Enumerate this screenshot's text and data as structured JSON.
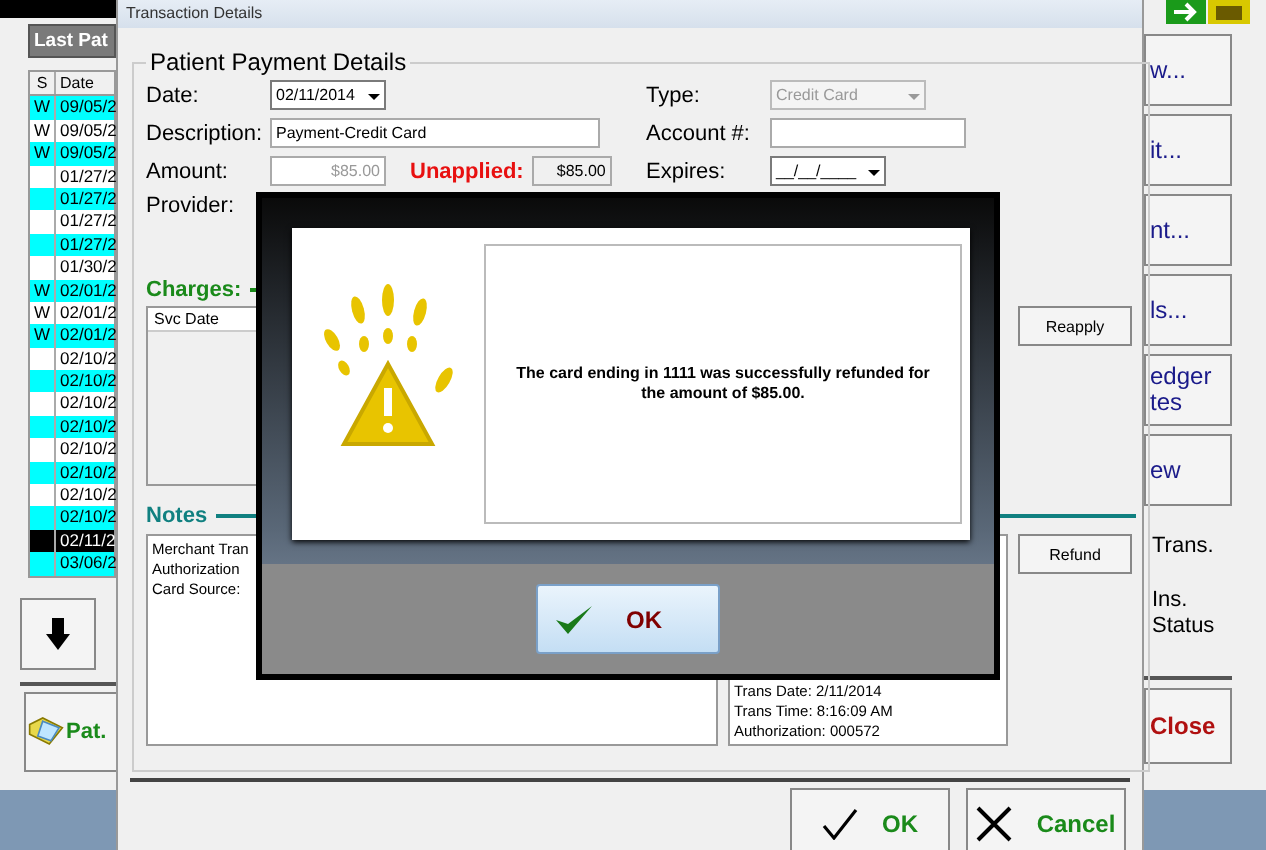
{
  "main_window": {
    "list_header": "Last Pat",
    "columns": [
      "S",
      "Date"
    ],
    "rows": [
      {
        "s": "W",
        "date": "09/05/2",
        "color": "#00ffff",
        "selected": false
      },
      {
        "s": "W",
        "date": "09/05/2",
        "color": "#ffffff",
        "selected": false
      },
      {
        "s": "W",
        "date": "09/05/2",
        "color": "#00ffff",
        "selected": false
      },
      {
        "s": "",
        "date": "01/27/2",
        "color": "#ffffff",
        "selected": false
      },
      {
        "s": "",
        "date": "01/27/2",
        "color": "#00ffff",
        "selected": false
      },
      {
        "s": "",
        "date": "01/27/2",
        "color": "#ffffff",
        "selected": false
      },
      {
        "s": "",
        "date": "01/27/2",
        "color": "#00ffff",
        "selected": false
      },
      {
        "s": "",
        "date": "01/30/2",
        "color": "#ffffff",
        "selected": false
      },
      {
        "s": "W",
        "date": "02/01/2",
        "color": "#00ffff",
        "selected": false
      },
      {
        "s": "W",
        "date": "02/01/2",
        "color": "#ffffff",
        "selected": false
      },
      {
        "s": "W",
        "date": "02/01/2",
        "color": "#00ffff",
        "selected": false
      },
      {
        "s": "",
        "date": "02/10/2",
        "color": "#ffffff",
        "selected": false
      },
      {
        "s": "",
        "date": "02/10/2",
        "color": "#00ffff",
        "selected": false
      },
      {
        "s": "",
        "date": "02/10/2",
        "color": "#ffffff",
        "selected": false
      },
      {
        "s": "",
        "date": "02/10/2",
        "color": "#00ffff",
        "selected": false
      },
      {
        "s": "",
        "date": "02/10/2",
        "color": "#ffffff",
        "selected": false
      },
      {
        "s": "",
        "date": "02/10/2",
        "color": "#00ffff",
        "selected": false
      },
      {
        "s": "",
        "date": "02/10/2",
        "color": "#ffffff",
        "selected": false
      },
      {
        "s": "",
        "date": "02/10/2",
        "color": "#00ffff",
        "selected": false
      },
      {
        "s": "",
        "date": "02/11/2",
        "color": "#000000",
        "selected": true
      },
      {
        "s": "",
        "date": "03/06/2",
        "color": "#00ffff",
        "selected": false
      }
    ],
    "patient_button": "Pat.",
    "side_buttons": [
      "w...",
      "it...",
      "nt...",
      "ls...",
      "edger\ntes",
      "ew"
    ],
    "side_texts": [
      "Trans.",
      "Ins.\nStatus"
    ],
    "close_button": "Close"
  },
  "transaction_dialog": {
    "title": "Transaction Details",
    "group_title": "Patient Payment Details",
    "date": {
      "label": "Date:",
      "value": "02/11/2014"
    },
    "type": {
      "label": "Type:",
      "value": "Credit Card",
      "disabled": true
    },
    "description": {
      "label": "Description:",
      "value": "Payment-Credit Card"
    },
    "account": {
      "label": "Account #:"
    },
    "amount": {
      "label": "Amount:",
      "value": "$85.00"
    },
    "unapplied": {
      "label": "Unapplied:",
      "value": "$85.00"
    },
    "expires": {
      "label": "Expires:",
      "value": "__/__/____"
    },
    "provider": {
      "label": "Provider:"
    },
    "charges": {
      "label": "Charges:",
      "columns": [
        "Svc Date"
      ]
    },
    "reapply_button": "Reapply",
    "notes": {
      "label": "Notes",
      "left_lines": [
        "Merchant Tran",
        "Authorization",
        "Card Source:"
      ],
      "right_lines": [
        "Trans Date: 2/11/2014",
        "Trans Time: 8:16:09 AM",
        "Authorization: 000572"
      ]
    },
    "refund_button": "Refund",
    "ok_button": "OK",
    "cancel_button": "Cancel"
  },
  "message_box": {
    "message": "The card ending in 1111 was successfully refunded for the amount of $85.00.",
    "ok_button": "OK"
  }
}
